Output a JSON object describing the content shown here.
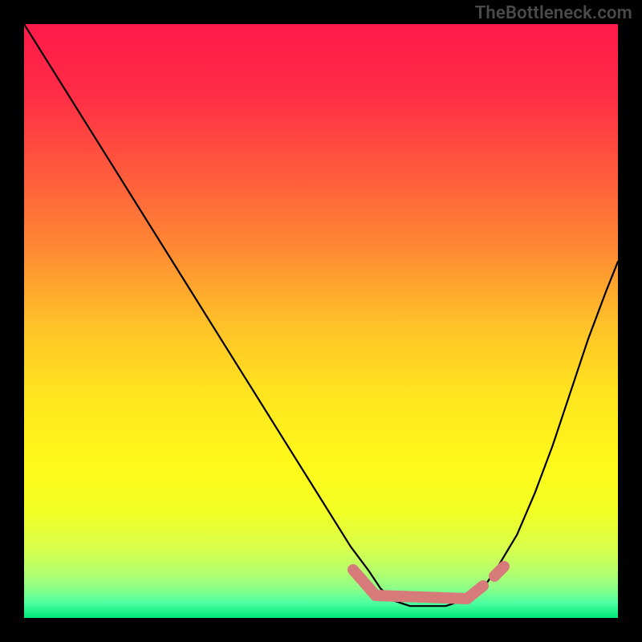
{
  "watermark": {
    "text": "TheBottleneck.com"
  },
  "gradient": {
    "stops": [
      {
        "offset": 0.0,
        "color": "#ff1a4a"
      },
      {
        "offset": 0.12,
        "color": "#ff2d46"
      },
      {
        "offset": 0.25,
        "color": "#ff5a3d"
      },
      {
        "offset": 0.38,
        "color": "#ff8a33"
      },
      {
        "offset": 0.5,
        "color": "#ffbf28"
      },
      {
        "offset": 0.62,
        "color": "#ffe41f"
      },
      {
        "offset": 0.74,
        "color": "#fff91a"
      },
      {
        "offset": 0.82,
        "color": "#f3ff25"
      },
      {
        "offset": 0.88,
        "color": "#d9ff4a"
      },
      {
        "offset": 0.92,
        "color": "#b8ff6a"
      },
      {
        "offset": 0.95,
        "color": "#8dff88"
      },
      {
        "offset": 0.975,
        "color": "#4dffa0"
      },
      {
        "offset": 1.0,
        "color": "#00e878"
      }
    ]
  },
  "overlay_segments": [
    {
      "x1": 410,
      "y1": 680,
      "x2": 438,
      "y2": 712
    },
    {
      "x1": 438,
      "y1": 712,
      "x2": 552,
      "y2": 716
    },
    {
      "x1": 552,
      "y1": 716,
      "x2": 572,
      "y2": 700
    },
    {
      "x1": 586,
      "y1": 688,
      "x2": 598,
      "y2": 676
    }
  ],
  "overlay_style": {
    "stroke": "#d67a7a",
    "width": 14
  },
  "chart_data": {
    "type": "line",
    "title": "",
    "xlabel": "",
    "ylabel": "",
    "xlim": [
      0,
      100
    ],
    "ylim": [
      0,
      100
    ],
    "series": [
      {
        "name": "curve",
        "x": [
          0,
          5,
          10,
          15,
          20,
          25,
          30,
          35,
          40,
          45,
          50,
          55,
          58,
          60,
          62,
          65,
          68,
          71,
          74,
          76,
          78,
          80,
          83,
          86,
          89,
          92,
          95,
          98,
          100
        ],
        "y": [
          100,
          92,
          84,
          76,
          68,
          60,
          52,
          44,
          36,
          28,
          20,
          12,
          8,
          5,
          3,
          2,
          2,
          2,
          3,
          4,
          6,
          9,
          14,
          21,
          29,
          38,
          47,
          55,
          60
        ]
      }
    ],
    "highlight": {
      "name": "optimal-zone",
      "x": [
        55,
        59,
        74,
        77,
        79,
        81
      ],
      "y": [
        8,
        4,
        3,
        5,
        7,
        9
      ]
    },
    "background_gradient_axis": "y",
    "background_meaning": "red=high bottleneck, green=low bottleneck"
  }
}
